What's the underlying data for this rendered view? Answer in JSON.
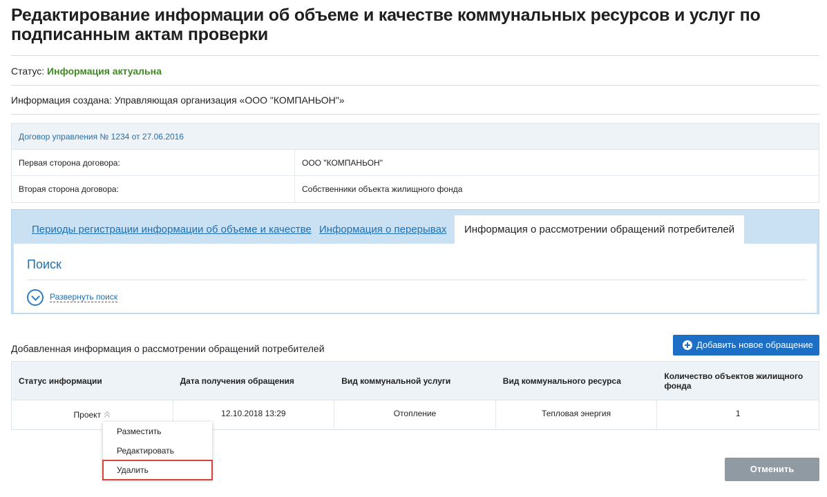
{
  "page": {
    "title": "Редактирование информации об объеме и качестве коммунальных ресурсов и услуг по подписанным актам проверки"
  },
  "status": {
    "label": "Статус:",
    "value": "Информация актуальна"
  },
  "created": {
    "text": "Информация создана: Управляющая организация «ООО \"КОМПАНЬОН\"»"
  },
  "contract": {
    "header": "Договор управления № 1234 от 27.06.2016",
    "rows": [
      {
        "label": "Первая сторона договора:",
        "value": "ООО \"КОМПАНЬОН\""
      },
      {
        "label": "Вторая сторона договора:",
        "value": "Собственники объекта жилищного фонда"
      }
    ]
  },
  "tabs": [
    {
      "label": "Периоды регистрации информации об объеме и качестве",
      "active": false
    },
    {
      "label": "Информация о перерывах",
      "active": false
    },
    {
      "label": "Информация о рассмотрении обращений потребителей",
      "active": true
    }
  ],
  "search": {
    "title": "Поиск",
    "expand_label": "Развернуть поиск"
  },
  "section": {
    "title": "Добавленная информация о рассмотрении обращений потребителей",
    "add_button": "Добавить новое обращение"
  },
  "table": {
    "columns": [
      "Статус информации",
      "Дата получения обращения",
      "Вид коммунальной услуги",
      "Вид коммунального ресурса",
      "Количество объектов жилищного фонда"
    ],
    "rows": [
      [
        "Проект",
        "12.10.2018 13:29",
        "Отопление",
        "Тепловая энергия",
        "1"
      ]
    ]
  },
  "row_menu": {
    "items": [
      "Разместить",
      "Редактировать",
      "Удалить"
    ],
    "highlighted": "Удалить"
  },
  "footer": {
    "cancel_button": "Отменить"
  },
  "colors": {
    "accent": "#1d6fc6",
    "status_ok": "#3d8b1f",
    "tab_bar": "#c9e1f2",
    "highlight_frame": "#d9413b"
  }
}
